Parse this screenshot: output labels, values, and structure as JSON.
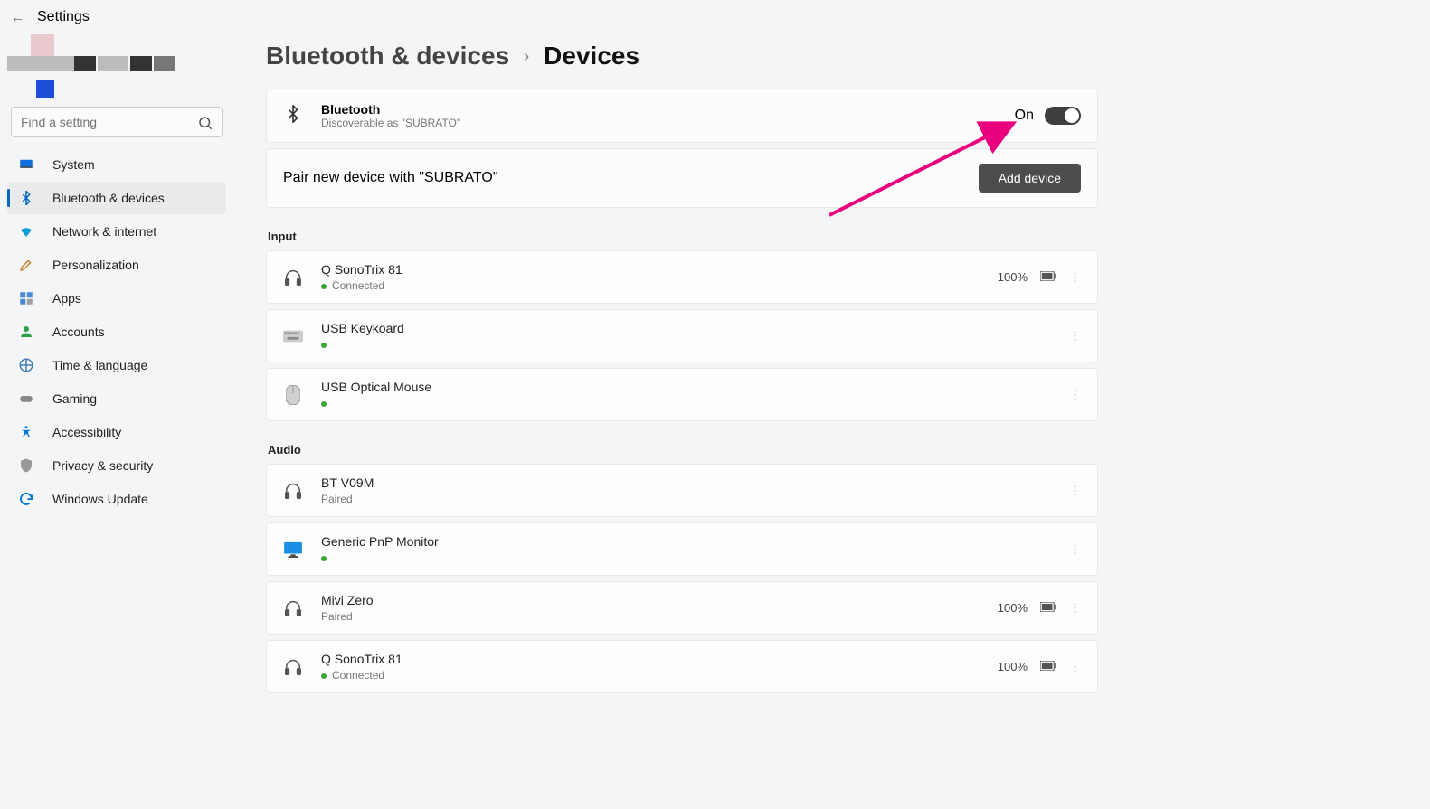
{
  "app_title": "Settings",
  "search": {
    "placeholder": "Find a setting"
  },
  "sidebar": {
    "items": [
      {
        "label": "System"
      },
      {
        "label": "Bluetooth & devices"
      },
      {
        "label": "Network & internet"
      },
      {
        "label": "Personalization"
      },
      {
        "label": "Apps"
      },
      {
        "label": "Accounts"
      },
      {
        "label": "Time & language"
      },
      {
        "label": "Gaming"
      },
      {
        "label": "Accessibility"
      },
      {
        "label": "Privacy & security"
      },
      {
        "label": "Windows Update"
      }
    ]
  },
  "breadcrumb": {
    "parent": "Bluetooth & devices",
    "current": "Devices"
  },
  "bluetooth": {
    "label": "Bluetooth",
    "discoverable": "Discoverable as \"SUBRATO\"",
    "state": "On"
  },
  "pair": {
    "text": "Pair new device with \"SUBRATO\"",
    "button": "Add device"
  },
  "groups": [
    {
      "title": "Input",
      "devices": [
        {
          "name": "Q SonoTrix 81",
          "status": "Connected",
          "dot": true,
          "battery": "100%",
          "icon": "headphones"
        },
        {
          "name": "USB Keykoard",
          "status": "",
          "dot": true,
          "battery": "",
          "icon": "keyboard"
        },
        {
          "name": "USB Optical Mouse",
          "status": "",
          "dot": true,
          "battery": "",
          "icon": "mouse"
        }
      ]
    },
    {
      "title": "Audio",
      "devices": [
        {
          "name": "BT-V09M",
          "status": "Paired",
          "dot": false,
          "battery": "",
          "icon": "headphones"
        },
        {
          "name": "Generic PnP Monitor",
          "status": "",
          "dot": true,
          "battery": "",
          "icon": "monitor"
        },
        {
          "name": "Mivi Zero",
          "status": "Paired",
          "dot": false,
          "battery": "100%",
          "icon": "headphones"
        },
        {
          "name": "Q SonoTrix 81",
          "status": "Connected",
          "dot": true,
          "battery": "100%",
          "icon": "headphones"
        }
      ]
    }
  ]
}
